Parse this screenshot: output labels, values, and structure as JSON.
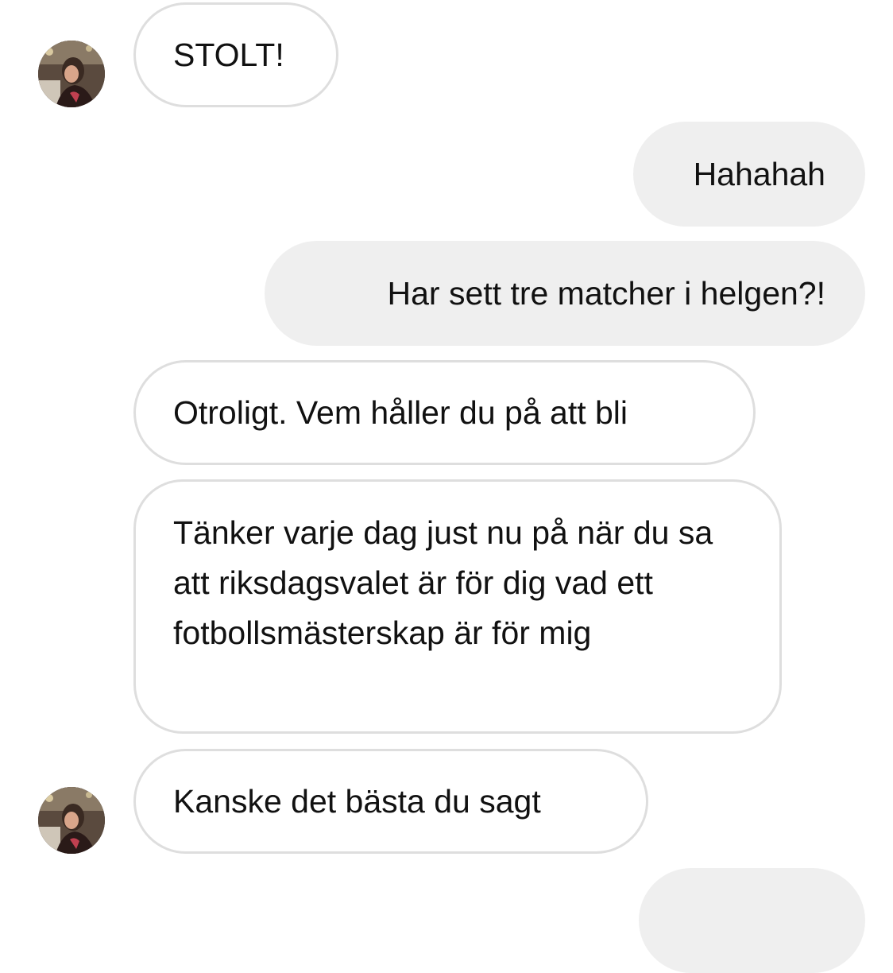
{
  "conversation": {
    "messages": [
      {
        "sender": "contact",
        "text": "STOLT!"
      },
      {
        "sender": "me",
        "text": "Hahahah"
      },
      {
        "sender": "me",
        "text": "Har sett tre matcher i helgen?!"
      },
      {
        "sender": "contact",
        "text": "Otroligt. Vem håller du på att bli"
      },
      {
        "sender": "contact",
        "text": "Tänker varje dag just nu på när du sa att riksdagsvalet är för dig vad ett fotbollsmästerskap är för mig"
      },
      {
        "sender": "contact",
        "text": "Kanske det bästa du sagt"
      },
      {
        "sender": "me",
        "text": ""
      }
    ]
  },
  "colors": {
    "received_bubble_border": "#dedede",
    "sent_bubble_bg": "#efefef",
    "text": "#111111",
    "background": "#ffffff"
  },
  "icons": {
    "contact_avatar": "profile-photo"
  }
}
